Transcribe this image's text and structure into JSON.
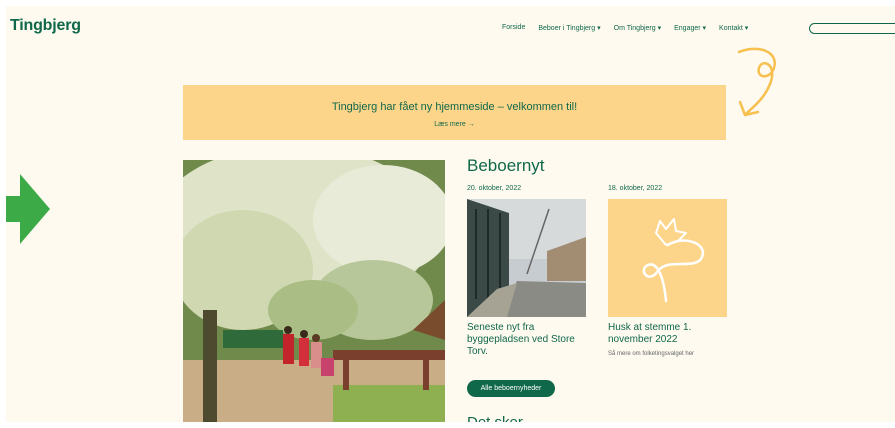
{
  "logo": "Tingbjerg",
  "nav": [
    "Forside",
    "Beboer i Tingbjerg ▾",
    "Om Tingbjerg ▾",
    "Engager ▾",
    "Kontakt ▾"
  ],
  "banner": {
    "title": "Tingbjerg har fået ny hjemmeside – velkommen til!",
    "link": "Læs mere →"
  },
  "news": {
    "heading": "Beboernyt",
    "cards": [
      {
        "date": "20. oktober, 2022",
        "title": "Seneste nyt fra byggepladsen ved Store Torv.",
        "sub": ""
      },
      {
        "date": "18. oktober, 2022",
        "title": "Husk at stemme 1. november 2022",
        "sub": "Så mere om folketingsvalget her"
      }
    ],
    "all_button": "Alle beboernyheder"
  },
  "events_heading": "Det sker",
  "colors": {
    "green": "#10684a",
    "yellow": "#fdd58a",
    "cream": "#fefaf0",
    "arrow": "#3daa48"
  }
}
